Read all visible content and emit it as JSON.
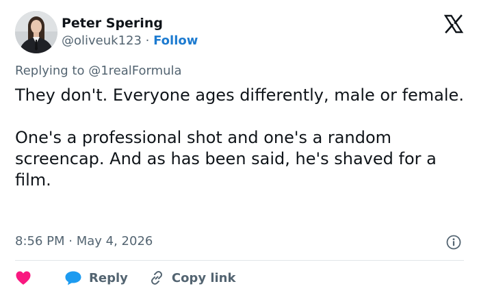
{
  "author": {
    "name": "Peter Spering",
    "handle": "@oliveuk123",
    "separator": " · ",
    "follow_label": "Follow"
  },
  "brand_icon": "x-logo-icon",
  "reply_context": {
    "prefix": "Replying to ",
    "handle": "@1realFormula"
  },
  "tweet": {
    "paragraphs": [
      "They don't. Everyone ages differently, male or female.",
      "One's a professional shot and one's a random screencap. And as has been said, he's shaved for a film."
    ]
  },
  "meta": {
    "time": "8:56 PM",
    "separator": " · ",
    "date": "May 4, 2026",
    "info_icon": "info-icon"
  },
  "actions": {
    "like_icon": "heart-icon",
    "reply_icon": "speech-bubble-icon",
    "reply_label": "Reply",
    "copy_icon": "link-icon",
    "copy_label": "Copy link"
  },
  "colors": {
    "text_primary": "#0f1419",
    "text_secondary": "#536471",
    "link_blue": "#1d7bd0",
    "heart_pink": "#f91880",
    "reply_blue": "#1d9bf0",
    "divider": "#e1e5e8"
  }
}
